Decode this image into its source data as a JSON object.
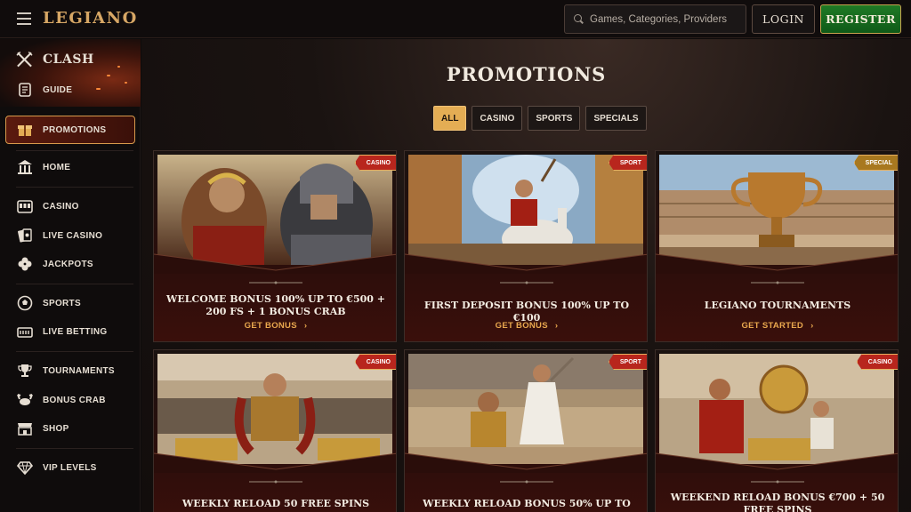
{
  "header": {
    "logo": "LEGIANO",
    "search_placeholder": "Games, Categories, Providers",
    "login_label": "LOGIN",
    "register_label": "REGISTER"
  },
  "sidebar": {
    "items": [
      {
        "label": "CLASH",
        "icon": "crossed-swords-icon"
      },
      {
        "label": "GUIDE",
        "icon": "scroll-icon"
      },
      {
        "label": "PROMOTIONS",
        "icon": "gift-icon"
      },
      {
        "label": "HOME",
        "icon": "temple-icon"
      },
      {
        "label": "CASINO",
        "icon": "slot-machine-icon"
      },
      {
        "label": "LIVE CASINO",
        "icon": "cards-icon"
      },
      {
        "label": "JACKPOTS",
        "icon": "clover-icon"
      },
      {
        "label": "SPORTS",
        "icon": "ball-icon"
      },
      {
        "label": "LIVE BETTING",
        "icon": "live-tv-icon"
      },
      {
        "label": "TOURNAMENTS",
        "icon": "trophy-icon"
      },
      {
        "label": "BONUS CRAB",
        "icon": "crab-icon"
      },
      {
        "label": "SHOP",
        "icon": "shop-icon"
      },
      {
        "label": "VIP LEVELS",
        "icon": "diamond-icon"
      }
    ],
    "active": "PROMOTIONS"
  },
  "main": {
    "title": "PROMOTIONS",
    "filters": [
      "ALL",
      "CASINO",
      "SPORTS",
      "SPECIALS"
    ],
    "active_filter": "ALL",
    "cards": [
      {
        "tag": "CASINO",
        "title": "WELCOME BONUS 100% UP TO €500 + 200 FS + 1 BONUS CRAB",
        "cta": "GET BONUS"
      },
      {
        "tag": "SPORT",
        "title": "FIRST DEPOSIT BONUS 100% UP TO €100",
        "cta": "GET BONUS"
      },
      {
        "tag": "SPECIAL",
        "title": "LEGIANO TOURNAMENTS",
        "cta": "GET STARTED"
      },
      {
        "tag": "CASINO",
        "title": "WEEKLY RELOAD 50 FREE SPINS",
        "cta": ""
      },
      {
        "tag": "SPORT",
        "title": "WEEKLY RELOAD BONUS 50% UP TO €500",
        "cta": ""
      },
      {
        "tag": "CASINO",
        "title": "WEEKEND RELOAD BONUS €700 + 50 FREE SPINS",
        "cta": ""
      }
    ]
  },
  "colors": {
    "accent_gold": "#e4ad54",
    "register_green": "#1f7a25",
    "tag_red": "#b8261d",
    "background": "#0d0b0b"
  }
}
